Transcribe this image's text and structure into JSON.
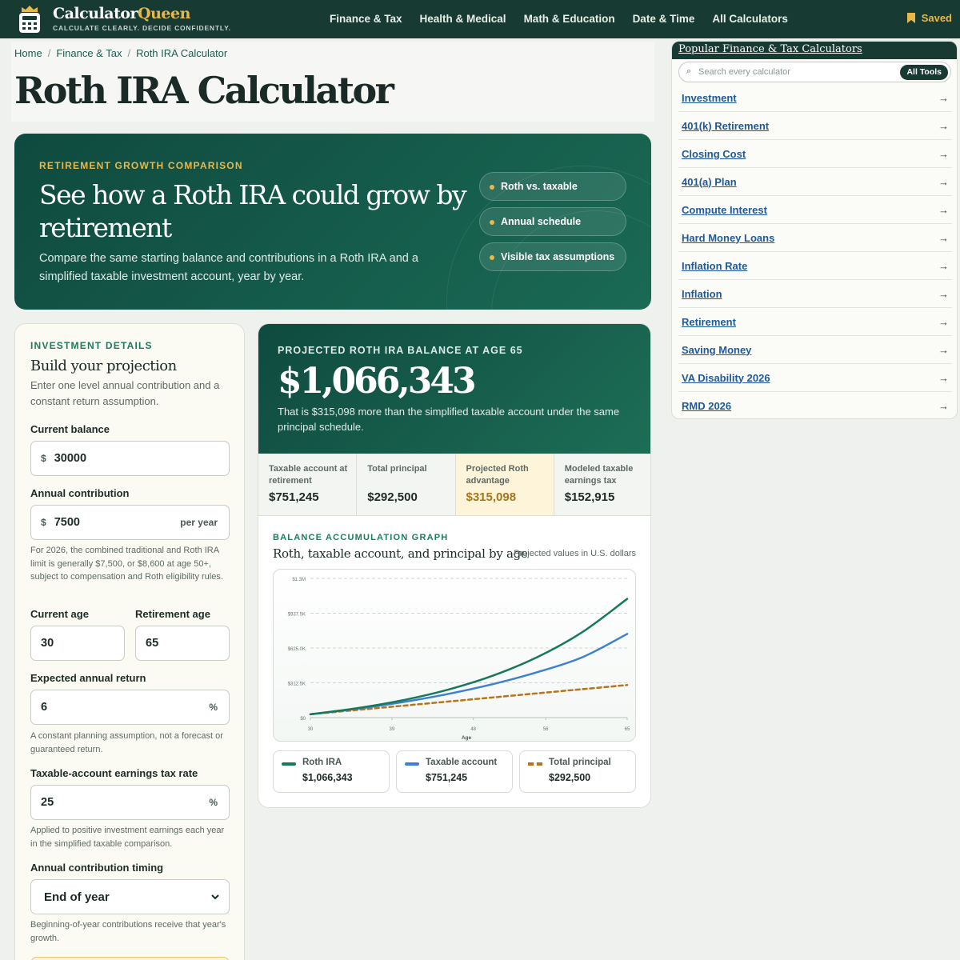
{
  "header": {
    "brand_main": "Calculator",
    "brand_accent": "Queen",
    "tagline": "CALCULATE CLEARLY. DECIDE CONFIDENTLY.",
    "nav": [
      "Finance & Tax",
      "Health & Medical",
      "Math & Education",
      "Date & Time",
      "All Calculators"
    ],
    "saved_label": "Saved"
  },
  "breadcrumb": [
    "Home",
    "Finance & Tax",
    "Roth IRA Calculator"
  ],
  "page_title": "Roth IRA Calculator",
  "hero": {
    "eyebrow": "RETIREMENT GROWTH COMPARISON",
    "title": "See how a Roth IRA could grow by retirement",
    "description": "Compare the same starting balance and contributions in a Roth IRA and a simplified taxable investment account, year by year.",
    "pills": [
      "Roth vs. taxable",
      "Annual schedule",
      "Visible tax assumptions"
    ]
  },
  "form": {
    "eyebrow": "INVESTMENT DETAILS",
    "title": "Build your projection",
    "subtitle": "Enter one level annual contribution and a constant return assumption.",
    "current_balance": {
      "label": "Current balance",
      "prefix": "$",
      "value": "30000"
    },
    "annual_contribution": {
      "label": "Annual contribution",
      "prefix": "$",
      "value": "7500",
      "suffix": "per year",
      "help": "For 2026, the combined traditional and Roth IRA limit is generally $7,500, or $8,600 at age 50+, subject to compensation and Roth eligibility rules."
    },
    "current_age": {
      "label": "Current age",
      "value": "30"
    },
    "retirement_age": {
      "label": "Retirement age",
      "value": "65"
    },
    "expected_return": {
      "label": "Expected annual return",
      "value": "6",
      "suffix": "%",
      "help": "A constant planning assumption, not a forecast or guaranteed return."
    },
    "tax_rate": {
      "label": "Taxable-account earnings tax rate",
      "value": "25",
      "suffix": "%",
      "help": "Applied to positive investment earnings each year in the simplified taxable comparison."
    },
    "timing": {
      "label": "Annual contribution timing",
      "value": "End of year",
      "help": "Beginning-of-year contributions receive that year's growth."
    }
  },
  "results": {
    "eyebrow": "PROJECTED ROTH IRA BALANCE AT AGE 65",
    "big_value": "$1,066,343",
    "note": "That is $315,098 more than the simplified taxable account under the same principal schedule.",
    "stats": [
      {
        "label": "Taxable account at retirement",
        "value": "$751,245"
      },
      {
        "label": "Total principal",
        "value": "$292,500"
      },
      {
        "label": "Projected Roth advantage",
        "value": "$315,098"
      },
      {
        "label": "Modeled taxable earnings tax",
        "value": "$152,915"
      }
    ],
    "graph_eyebrow": "BALANCE ACCUMULATION GRAPH",
    "graph_title": "Roth, taxable account, and principal by age",
    "graph_note": "Projected values in U.S. dollars",
    "legend": [
      {
        "name": "Roth IRA",
        "value": "$1,066,343",
        "color": "#17795b"
      },
      {
        "name": "Taxable account",
        "value": "$751,245",
        "color": "#3f7fd1"
      },
      {
        "name": "Total principal",
        "value": "$292,500",
        "color": "#b8741a"
      }
    ]
  },
  "chart_data": {
    "type": "line",
    "xlabel": "Age",
    "ylabel": "",
    "xlim": [
      30,
      65
    ],
    "ylim": [
      0,
      1250000
    ],
    "x_ticks": [
      "30",
      "39",
      "48",
      "56",
      "65"
    ],
    "y_ticks": [
      "$0",
      "$312.5K",
      "$625.0K",
      "$937.5K",
      "$1.3M"
    ],
    "grid": true,
    "x": [
      30,
      35,
      40,
      45,
      50,
      55,
      60,
      65
    ],
    "series": [
      {
        "name": "Roth IRA",
        "color": "#17795b",
        "values": [
          30000,
          82430,
          152590,
          246480,
          372120,
          540250,
          765250,
          1066343
        ]
      },
      {
        "name": "Taxable account",
        "color": "#3f7fd1",
        "values": [
          30000,
          77930,
          136620,
          208770,
          297450,
          406470,
          540480,
          751245
        ]
      },
      {
        "name": "Total principal",
        "color": "#b8741a",
        "values": [
          30000,
          67500,
          105000,
          142500,
          180000,
          217500,
          255000,
          292500
        ]
      }
    ]
  },
  "sidebar": {
    "title": "Popular Finance & Tax Calculators",
    "search_placeholder": "Search every calculator",
    "all_tools": "All Tools",
    "items": [
      "Investment",
      "401(k) Retirement",
      "Closing Cost",
      "401(a) Plan",
      "Compute Interest",
      "Hard Money Loans",
      "Inflation Rate",
      "Inflation",
      "Retirement",
      "Saving Money",
      "VA Disability 2026",
      "RMD 2026"
    ]
  }
}
